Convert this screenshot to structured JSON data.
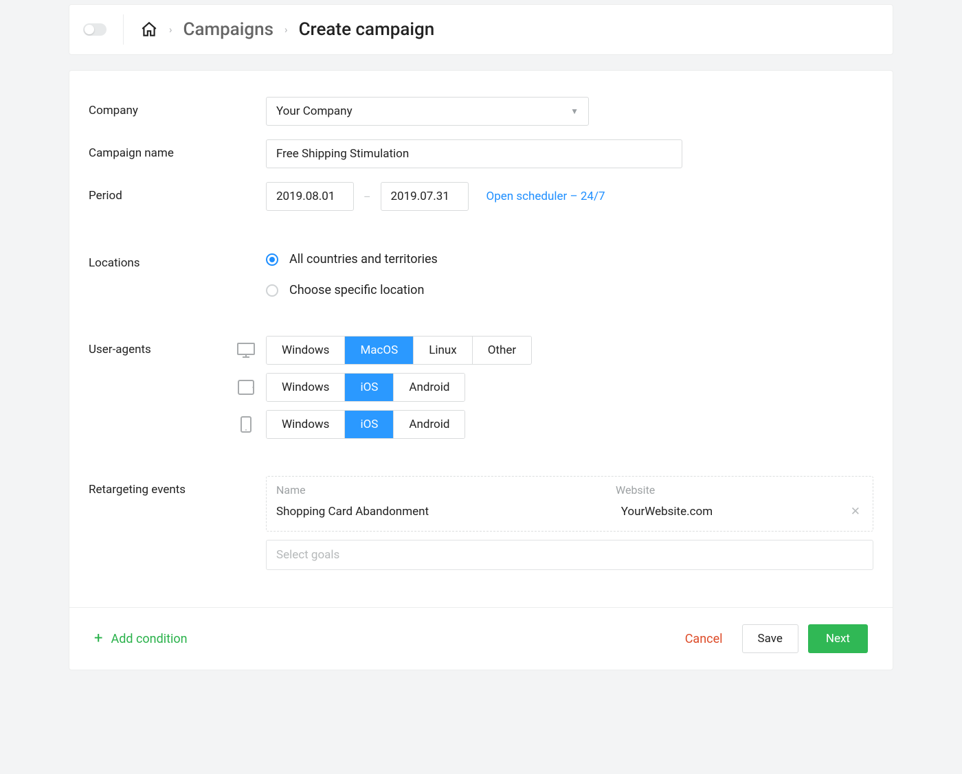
{
  "breadcrumb": {
    "parent": "Campaigns",
    "current": "Create campaign"
  },
  "form": {
    "company": {
      "label": "Company",
      "value": "Your Company"
    },
    "campaign_name": {
      "label": "Campaign name",
      "value": "Free Shipping Stimulation"
    },
    "period": {
      "label": "Period",
      "start": "2019.08.01",
      "end": "2019.07.31",
      "separator": "–",
      "scheduler_link": "Open scheduler – 24/7"
    },
    "locations": {
      "label": "Locations",
      "option_all": "All countries and territories",
      "option_specific": "Choose specific location",
      "selected": "all"
    },
    "user_agents": {
      "label": "User-agents",
      "desktop": {
        "options": [
          "Windows",
          "MacOS",
          "Linux",
          "Other"
        ],
        "selected": "MacOS"
      },
      "tablet": {
        "options": [
          "Windows",
          "iOS",
          "Android"
        ],
        "selected": "iOS"
      },
      "mobile": {
        "options": [
          "Windows",
          "iOS",
          "Android"
        ],
        "selected": "iOS"
      }
    },
    "events": {
      "label": "Retargeting events",
      "headers": {
        "name": "Name",
        "website": "Website"
      },
      "rows": [
        {
          "name": "Shopping Card Abandonment",
          "website": "YourWebsite.com"
        }
      ],
      "goals_placeholder": "Select goals"
    }
  },
  "footer": {
    "add_condition": "Add condition",
    "cancel": "Cancel",
    "save": "Save",
    "next": "Next"
  }
}
